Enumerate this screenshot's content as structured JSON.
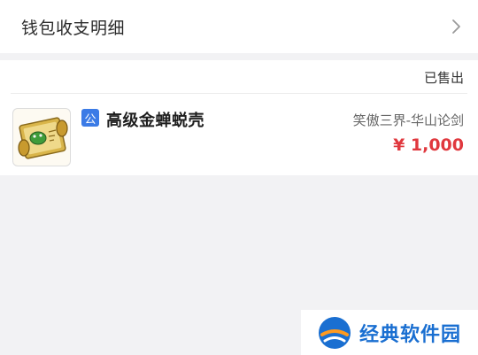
{
  "wallet": {
    "title": "钱包收支明细",
    "chevron_icon": "chevron-right-icon"
  },
  "order": {
    "status": "已售出",
    "badge": "公",
    "item_name": "高级金蝉蜕壳",
    "server": "笑傲三界-华山论剑",
    "price": "¥ 1,000",
    "thumbnail_icon": "treasure-scroll-icon",
    "price_color": "#e0383e",
    "badge_color": "#3b7be6"
  },
  "watermark": {
    "text": "经典软件园",
    "logo_icon": "site-logo-icon",
    "brand_color": "#1a6fd1"
  }
}
